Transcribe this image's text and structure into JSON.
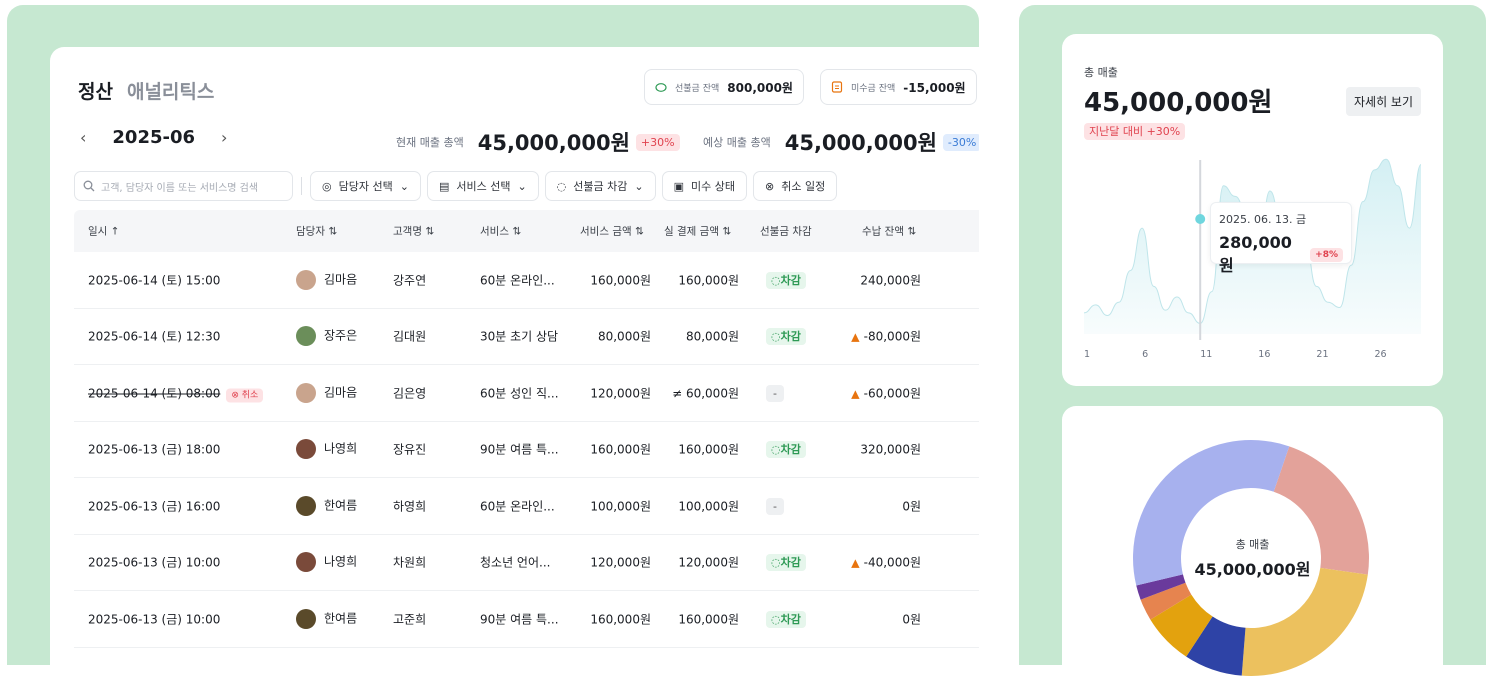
{
  "header": {
    "title": "정산",
    "subtitle": "애널리틱스"
  },
  "balances": {
    "prepaid": {
      "label": "선불금 잔액",
      "value": "800,000원"
    },
    "unpaid": {
      "label": "미수금 잔액",
      "value": "-15,000원"
    }
  },
  "period": {
    "month": "2025-06",
    "prev_icon": "chevron-left-icon",
    "next_icon": "chevron-right-icon"
  },
  "totals": {
    "current": {
      "label": "현재 매출 총액",
      "value": "45,000,000원",
      "change": "+30%"
    },
    "expected": {
      "label": "예상 매출 총액",
      "value": "45,000,000원",
      "change": "-30%"
    }
  },
  "filters": {
    "search_placeholder": "고객, 담당자 이름 또는 서비스명 검색",
    "manager": "담당자 선택",
    "service": "서비스 선택",
    "prepaid_deduct": "선불금 차감",
    "unpaid_status": "미수 상태",
    "cancel_schedule": "취소 일정"
  },
  "table": {
    "columns": [
      "일시 ↑",
      "담당자 ⇅",
      "고객명 ⇅",
      "서비스 ⇅",
      "서비스 금액 ⇅",
      "실 결제 금액 ⇅",
      "선불금 차감",
      "수납 잔액 ⇅"
    ],
    "rows": [
      {
        "datetime": "2025-06-14 (토) 15:00",
        "manager": "김마음",
        "customer": "강주연",
        "service": "60분 온라인...",
        "service_amount": "160,000원",
        "paid": "160,000원",
        "deduct": "차감",
        "balance": "240,000원"
      },
      {
        "datetime": "2025-06-14 (토) 12:30",
        "manager": "장주은",
        "customer": "김대원",
        "service": "30분 초기 상담",
        "service_amount": "80,000원",
        "paid": "80,000원",
        "deduct": "차감",
        "balance": "-80,000원"
      },
      {
        "datetime": "2025-06-14 (토) 08:00",
        "cancel": "취소",
        "manager": "김마음",
        "customer": "김은영",
        "service": "60분 성인 직...",
        "service_amount": "120,000원",
        "paid": "≠ 60,000원",
        "deduct": "-",
        "balance": "-60,000원"
      },
      {
        "datetime": "2025-06-13 (금) 18:00",
        "manager": "나영희",
        "customer": "장유진",
        "service": "90분 여름 특...",
        "service_amount": "160,000원",
        "paid": "160,000원",
        "deduct": "차감",
        "balance": "320,000원"
      },
      {
        "datetime": "2025-06-13 (금) 16:00",
        "manager": "한여름",
        "customer": "하영희",
        "service": "60분 온라인...",
        "service_amount": "100,000원",
        "paid": "100,000원",
        "deduct": "-",
        "balance": "0원"
      },
      {
        "datetime": "2025-06-13 (금) 10:00",
        "manager": "나영희",
        "customer": "차원희",
        "service": "청소년 언어...",
        "service_amount": "120,000원",
        "paid": "120,000원",
        "deduct": "차감",
        "balance": "-40,000원"
      },
      {
        "datetime": "2025-06-13 (금) 10:00",
        "manager": "한여름",
        "customer": "고준희",
        "service": "90분 여름 특...",
        "service_amount": "160,000원",
        "paid": "160,000원",
        "deduct": "차감",
        "balance": "0원"
      }
    ]
  },
  "sales_card": {
    "label": "총 매출",
    "value": "45,000,000원",
    "detail_button": "자세히 보기",
    "change_badge": "지난달 대비 +30%",
    "tooltip": {
      "date": "2025. 06. 13. 금",
      "value": "280,000원",
      "change": "+8%"
    }
  },
  "donut_card": {
    "label": "총 매출",
    "value": "45,000,000원"
  },
  "colors": {
    "panel": "#c6e8d1",
    "accent_red": "#e0434f",
    "accent_green": "#2e9a55",
    "area": "#cfeef2"
  },
  "chart_data": [
    {
      "type": "area",
      "x": [
        1,
        2,
        3,
        4,
        5,
        6,
        7,
        8,
        9,
        10,
        11,
        12,
        13,
        14,
        15,
        16,
        17,
        18,
        19,
        20,
        21,
        22,
        23,
        24,
        25,
        26,
        27,
        28,
        29,
        30
      ],
      "values": [
        40,
        55,
        35,
        60,
        120,
        200,
        90,
        45,
        70,
        40,
        20,
        80,
        280,
        260,
        230,
        150,
        270,
        210,
        240,
        180,
        90,
        60,
        50,
        130,
        250,
        310,
        330,
        280,
        200,
        320
      ],
      "xticks": [
        "1",
        "6",
        "11",
        "16",
        "21",
        "26"
      ],
      "highlight_x": 11
    },
    {
      "type": "pie",
      "slices": [
        {
          "value": 22,
          "color": "#e3a29a"
        },
        {
          "value": 24,
          "color": "#ecc15e"
        },
        {
          "value": 8,
          "color": "#2e43a6"
        },
        {
          "value": 7,
          "color": "#e3a20e"
        },
        {
          "value": 3,
          "color": "#e6844f"
        },
        {
          "value": 2,
          "color": "#6a3a9c"
        },
        {
          "value": 34,
          "color": "#a7b1ee"
        }
      ]
    }
  ]
}
